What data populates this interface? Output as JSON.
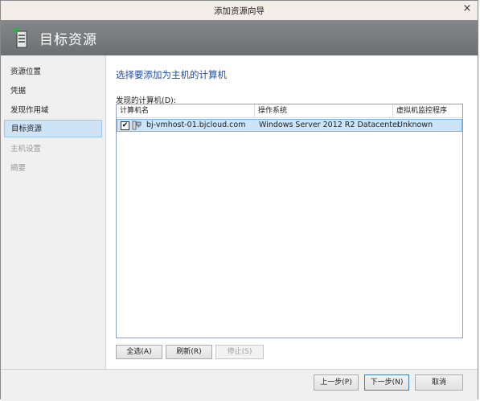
{
  "window": {
    "title": "添加资源向导",
    "close_glyph": "×"
  },
  "header": {
    "title": "目标资源",
    "icon": "server-add-icon"
  },
  "nav": {
    "items": [
      {
        "label": "资源位置",
        "state": "normal"
      },
      {
        "label": "凭据",
        "state": "normal"
      },
      {
        "label": "发现作用域",
        "state": "normal"
      },
      {
        "label": "目标资源",
        "state": "selected"
      },
      {
        "label": "主机设置",
        "state": "disabled"
      },
      {
        "label": "摘要",
        "state": "disabled"
      }
    ]
  },
  "main": {
    "heading": "选择要添加为主机的计算机",
    "list_caption": "发现的计算机(D):",
    "columns": [
      "计算机名",
      "操作系统",
      "虚拟机监控程序"
    ],
    "rows": [
      {
        "checked": true,
        "check_glyph": "✔",
        "name": "bj-vmhost-01.bjcloud.com",
        "os": "Windows Server 2012 R2 Datacenter",
        "hypervisor": "Unknown"
      }
    ],
    "buttons": {
      "select_all": "全选(A)",
      "refresh": "刷新(R)",
      "stop": "停止(S)"
    }
  },
  "footer": {
    "previous": "上一步(P)",
    "next": "下一步(N)",
    "cancel": "取消"
  },
  "colors": {
    "heading": "#1f4fa0",
    "banner": "#777a7d",
    "selected_row": "#cce4f7"
  }
}
